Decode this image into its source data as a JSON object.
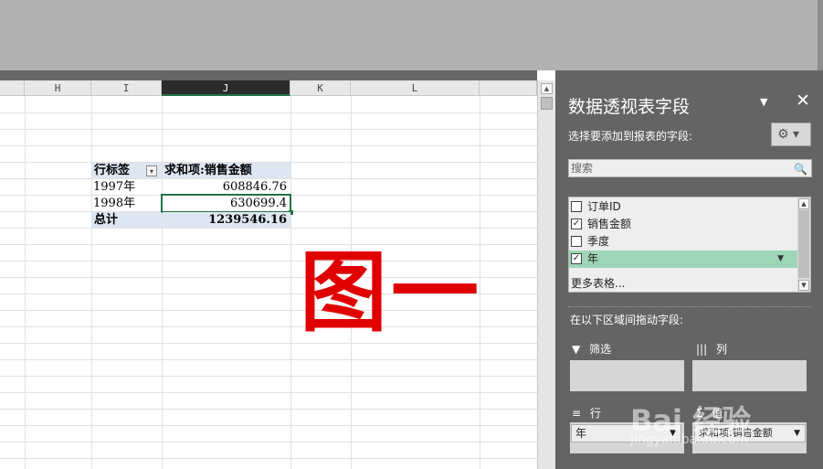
{
  "columns": [
    "H",
    "I",
    "J",
    "K",
    "L"
  ],
  "pivot": {
    "header_row_label": "行标签",
    "header_value_label": "求和项:销售金额",
    "rows": [
      {
        "label": "1997年",
        "value": "608846.76"
      },
      {
        "label": "1998年",
        "value": "630699.4"
      }
    ],
    "total_label": "总计",
    "total_value": "1239546.16"
  },
  "annotation": "图一",
  "pane": {
    "title": "数据透视表字段",
    "dropdown_glyph": "▼",
    "close_glyph": "✕",
    "subtitle": "选择要添加到报表的字段:",
    "gear_glyph": "⚙ ▾",
    "search_placeholder": "搜索",
    "fields": [
      {
        "label": "订单ID",
        "checked": false,
        "mark": ""
      },
      {
        "label": "销售金额",
        "checked": true,
        "mark": "✓"
      },
      {
        "label": "季度",
        "checked": false,
        "mark": ""
      },
      {
        "label": "年",
        "checked": true,
        "mark": "✓"
      }
    ],
    "more_tables": "更多表格...",
    "drag_hint": "在以下区域间拖动字段:",
    "areas": {
      "filter": "筛选",
      "columns": "列",
      "rows": "行",
      "values": "值"
    },
    "row_chip": "年",
    "value_chip": "求和项:销售金额"
  },
  "watermark": {
    "text": "Bai 经验",
    "url": "jingyan.baidu.com"
  },
  "colors": {
    "accent_green": "#217346",
    "annotation_red": "#e00000",
    "pane_bg": "#646464"
  }
}
